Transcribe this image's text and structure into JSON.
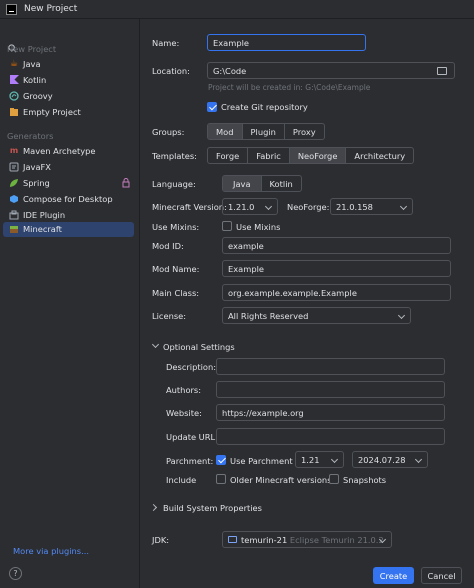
{
  "window": {
    "title": "New Project"
  },
  "sidebar": {
    "new_project_heading": "New Project",
    "new_project_items": [
      {
        "label": "Java",
        "icon": "java-icon",
        "color": "#e76f00"
      },
      {
        "label": "Kotlin",
        "icon": "kotlin-icon",
        "color": "#b07ef8"
      },
      {
        "label": "Groovy",
        "icon": "groovy-icon",
        "color": "#5fb8b1"
      },
      {
        "label": "Empty Project",
        "icon": "empty-project-icon",
        "color": "#e0a040"
      }
    ],
    "generators_heading": "Generators",
    "generator_items": [
      {
        "label": "Maven Archetype",
        "icon": "maven-icon",
        "color": "#c75450"
      },
      {
        "label": "JavaFX",
        "icon": "javafx-icon",
        "color": "#a0a8b4"
      },
      {
        "label": "Spring",
        "icon": "spring-icon",
        "color": "#6db33f"
      },
      {
        "label": "Compose for Desktop",
        "icon": "compose-icon",
        "color": "#4ea0f7"
      },
      {
        "label": "IDE Plugin",
        "icon": "ide-plugin-icon",
        "color": "#a0a8b4"
      },
      {
        "label": "Minecraft",
        "icon": "minecraft-icon",
        "color": "#7cb342",
        "selected": true
      }
    ],
    "more_plugins": "More via plugins..."
  },
  "form": {
    "name_label": "Name:",
    "name_value": "Example",
    "location_label": "Location:",
    "location_value": "G:\\Code",
    "location_hint": "Project will be created in: G:\\Code\\Example",
    "git_label": "Create Git repository",
    "git_checked": true,
    "groups_label": "Groups:",
    "groups": [
      "Mod",
      "Plugin",
      "Proxy"
    ],
    "groups_selected": "Mod",
    "templates_label": "Templates:",
    "templates": [
      "Forge",
      "Fabric",
      "NeoForge",
      "Architectury"
    ],
    "templates_selected": "NeoForge",
    "language_label": "Language:",
    "languages": [
      "Java",
      "Kotlin"
    ],
    "language_selected": "Java",
    "mc_version_label": "Minecraft Version:",
    "mc_version_value": "1.21.0",
    "neoforge_label": "NeoForge:",
    "neoforge_value": "21.0.158",
    "mixins_label": "Use Mixins:",
    "mixins_check_label": "Use Mixins",
    "mod_id_label": "Mod ID:",
    "mod_id_value": "example",
    "mod_name_label": "Mod Name:",
    "mod_name_value": "Example",
    "main_class_label": "Main Class:",
    "main_class_value": "org.example.example.Example",
    "license_label": "License:",
    "license_value": "All Rights Reserved"
  },
  "optional": {
    "heading": "Optional Settings",
    "description_label": "Description:",
    "description_value": "",
    "authors_label": "Authors:",
    "authors_value": "",
    "website_label": "Website:",
    "website_value": "https://example.org",
    "update_url_label": "Update URL:",
    "update_url_value": "",
    "parchment_label": "Parchment:",
    "use_parchment_label": "Use Parchment",
    "parchment_version": "1.21",
    "parchment_date": "2024.07.28",
    "include_label": "Include",
    "older_versions_label": "Older Minecraft versions",
    "snapshots_label": "Snapshots"
  },
  "build": {
    "heading": "Build System Properties"
  },
  "jdk": {
    "label": "JDK:",
    "name": "temurin-21",
    "detail": "Eclipse Temurin 21.0.2"
  },
  "buttons": {
    "create": "Create",
    "cancel": "Cancel",
    "help": "?"
  }
}
